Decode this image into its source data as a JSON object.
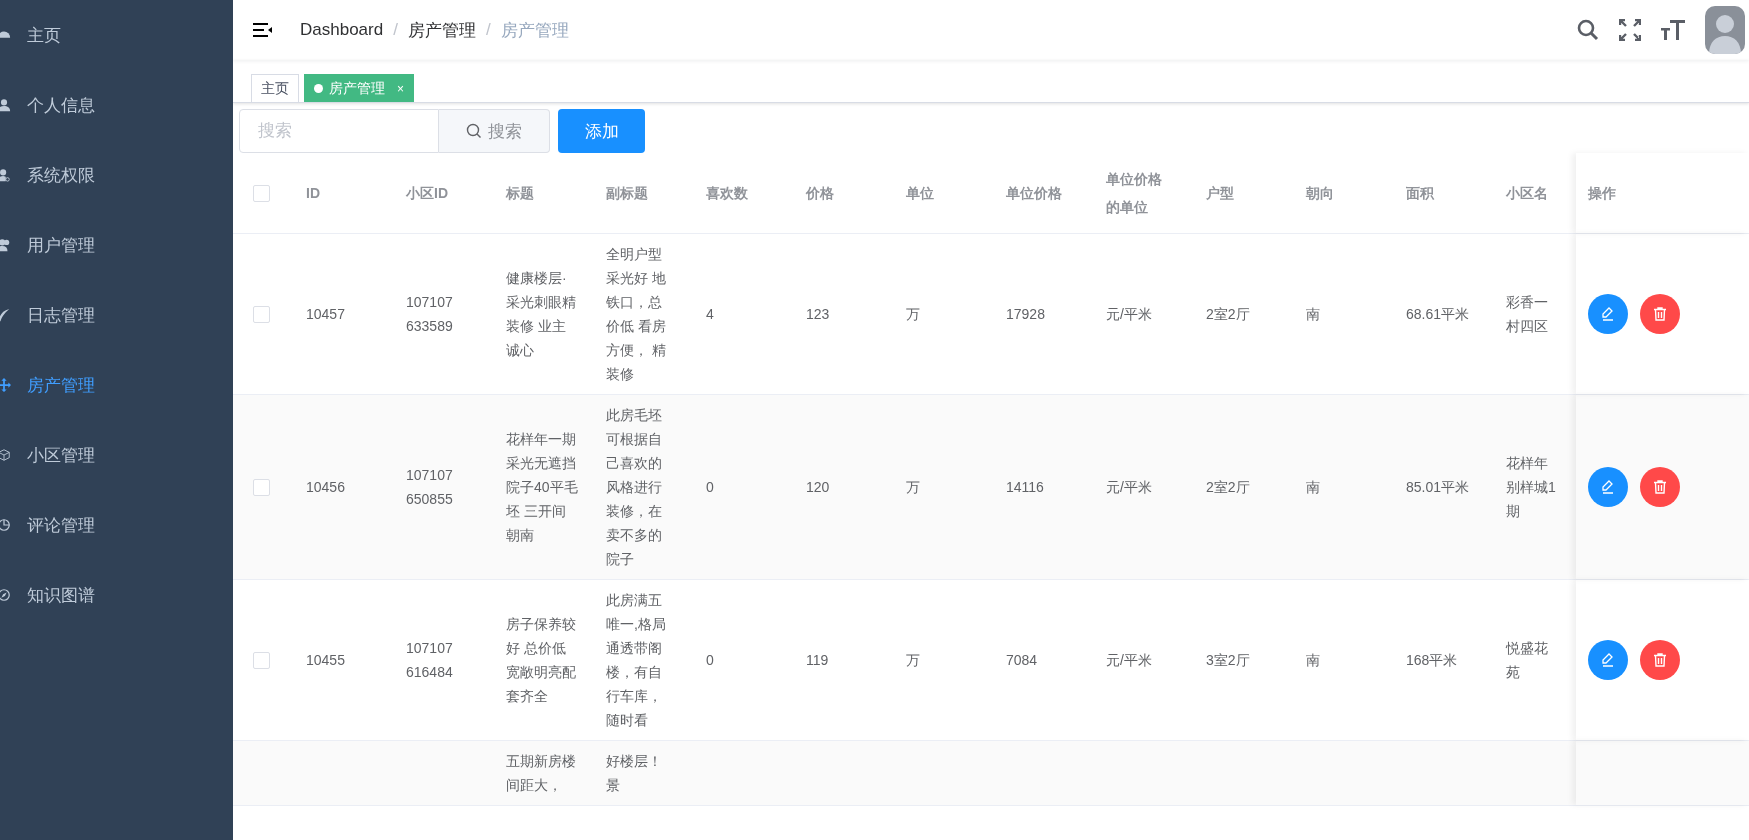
{
  "sidebar": {
    "items": [
      {
        "label": "主页",
        "selected": false
      },
      {
        "label": "个人信息",
        "selected": false
      },
      {
        "label": "系统权限",
        "selected": false
      },
      {
        "label": "用户管理",
        "selected": false
      },
      {
        "label": "日志管理",
        "selected": false
      },
      {
        "label": "房产管理",
        "selected": true
      },
      {
        "label": "小区管理",
        "selected": false
      },
      {
        "label": "评论管理",
        "selected": false
      },
      {
        "label": "知识图谱",
        "selected": false
      }
    ]
  },
  "breadcrumb": {
    "items": [
      "Dashboard",
      "房产管理",
      "房产管理"
    ],
    "separator": "/"
  },
  "tags": [
    {
      "label": "主页",
      "selected": false
    },
    {
      "label": "房产管理",
      "selected": true,
      "close": "×"
    }
  ],
  "search": {
    "placeholder": "搜索",
    "button": "搜索"
  },
  "add_button": "添加",
  "table": {
    "all_checked": false,
    "columns": [
      "ID",
      "小区ID",
      "标题",
      "副标题",
      "喜欢数",
      "价格",
      "单位",
      "单位价格",
      "单位价格的单位",
      "户型",
      "朝向",
      "面积",
      "小区名",
      "操作"
    ],
    "rows": [
      {
        "checked": false,
        "actions": true,
        "cells": [
          "10457",
          "107107633589",
          "健康楼层·采光刺眼精装修 业主诚心",
          "全明户型采光好 地铁口，总价低 看房方便， 精装修",
          "4",
          "123",
          "万",
          "17928",
          "元/平米",
          "2室2厅",
          "南",
          "68.61平米",
          "彩香一村四区"
        ]
      },
      {
        "checked": false,
        "actions": true,
        "cells": [
          "10456",
          "107107650855",
          "花样年一期采光无遮挡院子40平毛坯 三开间朝南",
          "此房毛坯可根据自己喜欢的风格进行装修，在卖不多的院子",
          "0",
          "120",
          "万",
          "14116",
          "元/平米",
          "2室2厅",
          "南",
          "85.01平米",
          "花样年别样城1期"
        ]
      },
      {
        "checked": false,
        "actions": true,
        "cells": [
          "10455",
          "107107616484",
          "房子保养较好 总价低宽敞明亮配套齐全",
          "此房满五唯一,格局通透带阁楼，有自行车库，随时看",
          "0",
          "119",
          "万",
          "7084",
          "元/平米",
          "3室2厅",
          "南",
          "168平米",
          "悦盛花苑"
        ]
      },
      {
        "actions": false,
        "cells": [
          "",
          "",
          "五期新房楼间距大，",
          "好楼层！景",
          "",
          "",
          "",
          "",
          "",
          "",
          "",
          "",
          ""
        ]
      }
    ]
  }
}
